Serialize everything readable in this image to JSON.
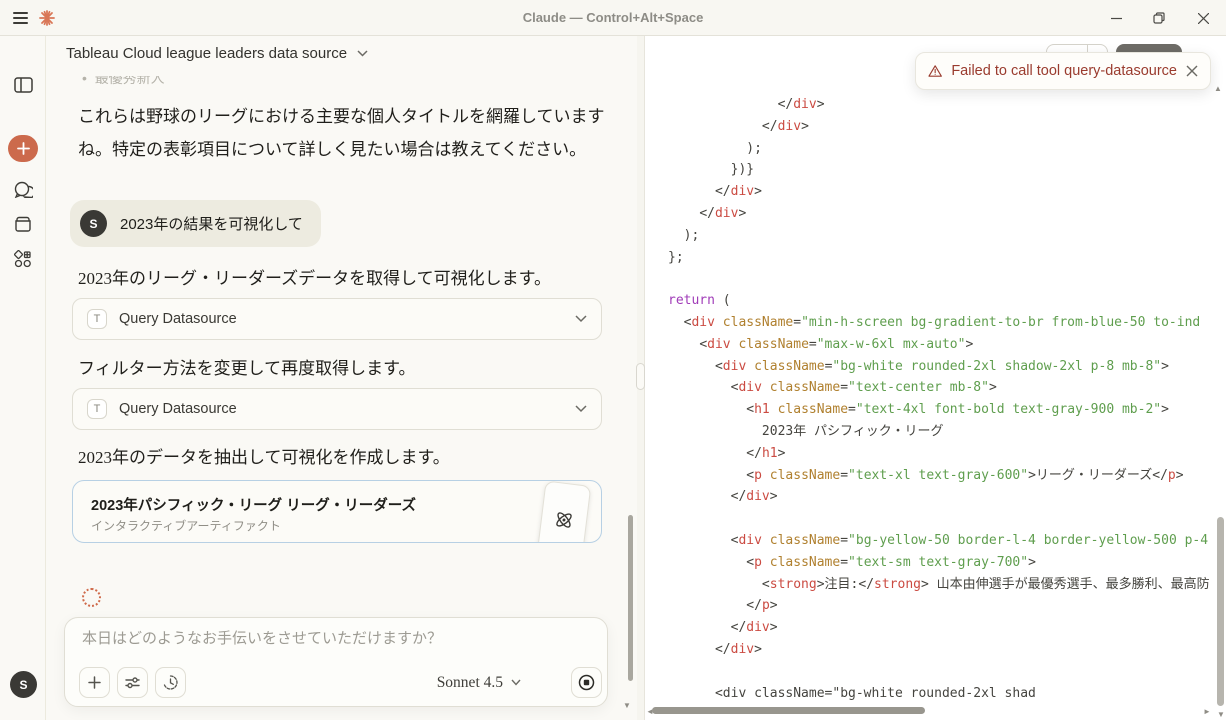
{
  "window": {
    "title": "Claude — Control+Alt+Space",
    "controls": {
      "minimize": "minimize",
      "restore": "restore",
      "close": "close"
    }
  },
  "rail": {
    "avatar_initial": "S",
    "icons": [
      "sidebar-toggle-icon",
      "new-chat-icon",
      "chats-icon",
      "projects-icon",
      "connectors-icon"
    ]
  },
  "chat": {
    "header": {
      "title": "Tableau Cloud league leaders data source"
    },
    "clipped_list_item": "最優秀新人",
    "intro_line1": "これらは野球のリーグにおける主要な個人タイトルを網羅しています",
    "intro_line2": "ね。特定の表彰項目について詳しく見たい場合は教えてください。",
    "user_message": {
      "avatar_initial": "S",
      "text": "2023年の結果を可視化して"
    },
    "steps": [
      {
        "text": "2023年のリーグ・リーダーズデータを取得して可視化します。"
      },
      {
        "label": "Query Datasource",
        "chip": "T"
      },
      {
        "text": "フィルター方法を変更して再度取得します。"
      },
      {
        "label": "Query Datasource",
        "chip": "T"
      },
      {
        "text": "2023年のデータを抽出して可視化を作成します。"
      }
    ],
    "artifact": {
      "title": "2023年パシフィック・リーグ リーグ・リーダーズ",
      "subtitle": "インタラクティブアーティファクト"
    },
    "composer": {
      "placeholder": "本日はどのようなお手伝いをさせていただけますか？",
      "model": "Sonnet 4.5"
    }
  },
  "toast": {
    "text": "Failed to call tool query-datasource"
  },
  "code": {
    "lines": [
      {
        "ind": 14,
        "tok": [
          [
            "p",
            "</"
          ],
          [
            "t",
            "div"
          ],
          [
            "p",
            ">"
          ]
        ]
      },
      {
        "ind": 12,
        "tok": [
          [
            "p",
            "</"
          ],
          [
            "t",
            "div"
          ],
          [
            "p",
            ">"
          ]
        ]
      },
      {
        "ind": 10,
        "tok": [
          [
            "p",
            ");"
          ]
        ]
      },
      {
        "ind": 8,
        "tok": [
          [
            "p",
            "})}"
          ]
        ]
      },
      {
        "ind": 6,
        "tok": [
          [
            "p",
            "</"
          ],
          [
            "t",
            "div"
          ],
          [
            "p",
            ">"
          ]
        ]
      },
      {
        "ind": 4,
        "tok": [
          [
            "p",
            "</"
          ],
          [
            "t",
            "div"
          ],
          [
            "p",
            ">"
          ]
        ]
      },
      {
        "ind": 2,
        "tok": [
          [
            "p",
            ");"
          ]
        ]
      },
      {
        "ind": 0,
        "tok": [
          [
            "p",
            "};"
          ]
        ]
      },
      {
        "ind": 0,
        "tok": []
      },
      {
        "ind": 0,
        "tok": [
          [
            "k",
            "return"
          ],
          [
            "p",
            " ("
          ]
        ]
      },
      {
        "ind": 2,
        "tok": [
          [
            "p",
            "<"
          ],
          [
            "t",
            "div"
          ],
          [
            "p",
            " "
          ],
          [
            "a",
            "className"
          ],
          [
            "p",
            "="
          ],
          [
            "s",
            "\"min-h-screen bg-gradient-to-br from-blue-50 to-ind"
          ]
        ]
      },
      {
        "ind": 4,
        "tok": [
          [
            "p",
            "<"
          ],
          [
            "t",
            "div"
          ],
          [
            "p",
            " "
          ],
          [
            "a",
            "className"
          ],
          [
            "p",
            "="
          ],
          [
            "s",
            "\"max-w-6xl mx-auto\""
          ],
          [
            "p",
            ">"
          ]
        ]
      },
      {
        "ind": 6,
        "tok": [
          [
            "p",
            "<"
          ],
          [
            "t",
            "div"
          ],
          [
            "p",
            " "
          ],
          [
            "a",
            "className"
          ],
          [
            "p",
            "="
          ],
          [
            "s",
            "\"bg-white rounded-2xl shadow-2xl p-8 mb-8\""
          ],
          [
            "p",
            ">"
          ]
        ]
      },
      {
        "ind": 8,
        "tok": [
          [
            "p",
            "<"
          ],
          [
            "t",
            "div"
          ],
          [
            "p",
            " "
          ],
          [
            "a",
            "className"
          ],
          [
            "p",
            "="
          ],
          [
            "s",
            "\"text-center mb-8\""
          ],
          [
            "p",
            ">"
          ]
        ]
      },
      {
        "ind": 10,
        "tok": [
          [
            "p",
            "<"
          ],
          [
            "t",
            "h1"
          ],
          [
            "p",
            " "
          ],
          [
            "a",
            "className"
          ],
          [
            "p",
            "="
          ],
          [
            "s",
            "\"text-4xl font-bold text-gray-900 mb-2\""
          ],
          [
            "p",
            ">"
          ]
        ]
      },
      {
        "ind": 12,
        "tok": [
          [
            "x",
            "2023年 パシフィック・リーグ"
          ]
        ]
      },
      {
        "ind": 10,
        "tok": [
          [
            "p",
            "</"
          ],
          [
            "t",
            "h1"
          ],
          [
            "p",
            ">"
          ]
        ]
      },
      {
        "ind": 10,
        "tok": [
          [
            "p",
            "<"
          ],
          [
            "t",
            "p"
          ],
          [
            "p",
            " "
          ],
          [
            "a",
            "className"
          ],
          [
            "p",
            "="
          ],
          [
            "s",
            "\"text-xl text-gray-600\""
          ],
          [
            "p",
            ">"
          ],
          [
            "x",
            "リーグ・リーダーズ"
          ],
          [
            "p",
            "</"
          ],
          [
            "t",
            "p"
          ],
          [
            "p",
            ">"
          ]
        ]
      },
      {
        "ind": 8,
        "tok": [
          [
            "p",
            "</"
          ],
          [
            "t",
            "div"
          ],
          [
            "p",
            ">"
          ]
        ]
      },
      {
        "ind": 0,
        "tok": []
      },
      {
        "ind": 8,
        "tok": [
          [
            "p",
            "<"
          ],
          [
            "t",
            "div"
          ],
          [
            "p",
            " "
          ],
          [
            "a",
            "className"
          ],
          [
            "p",
            "="
          ],
          [
            "s",
            "\"bg-yellow-50 border-l-4 border-yellow-500 p-4"
          ]
        ]
      },
      {
        "ind": 10,
        "tok": [
          [
            "p",
            "<"
          ],
          [
            "t",
            "p"
          ],
          [
            "p",
            " "
          ],
          [
            "a",
            "className"
          ],
          [
            "p",
            "="
          ],
          [
            "s",
            "\"text-sm text-gray-700\""
          ],
          [
            "p",
            ">"
          ]
        ]
      },
      {
        "ind": 12,
        "tok": [
          [
            "p",
            "<"
          ],
          [
            "t",
            "strong"
          ],
          [
            "p",
            ">"
          ],
          [
            "x",
            "注目:"
          ],
          [
            "p",
            "</"
          ],
          [
            "t",
            "strong"
          ],
          [
            "p",
            ">"
          ],
          [
            "x",
            " 山本由伸選手が最優秀選手、最多勝利、最高防"
          ]
        ]
      },
      {
        "ind": 10,
        "tok": [
          [
            "p",
            "</"
          ],
          [
            "t",
            "p"
          ],
          [
            "p",
            ">"
          ]
        ]
      },
      {
        "ind": 8,
        "tok": [
          [
            "p",
            "</"
          ],
          [
            "t",
            "div"
          ],
          [
            "p",
            ">"
          ]
        ]
      },
      {
        "ind": 6,
        "tok": [
          [
            "p",
            "</"
          ],
          [
            "t",
            "div"
          ],
          [
            "p",
            ">"
          ]
        ]
      },
      {
        "ind": 0,
        "tok": []
      },
      {
        "ind": 6,
        "tok": [
          [
            "u",
            "<div className=\"bg-white rounded-2xl shad"
          ]
        ]
      }
    ]
  },
  "colors": {
    "accent_orange": "#cc6a4c",
    "toast_red": "#9a3b2e",
    "artifact_border_blue": "#b7d0e4",
    "code_tag": "#cb4b42",
    "code_attr": "#b0802f",
    "code_string": "#5f9e4e",
    "code_keyword": "#a03cb8"
  }
}
